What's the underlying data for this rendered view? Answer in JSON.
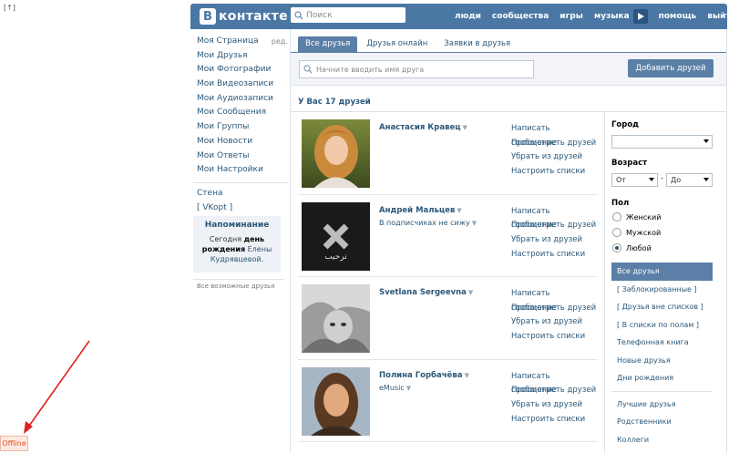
{
  "corner_mark": "[↑]",
  "header": {
    "logo_letter": "В",
    "logo_text": "контакте",
    "search_placeholder": "Поиск",
    "nav": [
      "люди",
      "сообщества",
      "игры",
      "музыка",
      "помощь",
      "выйти"
    ]
  },
  "menu": {
    "items": [
      "Моя Страница",
      "Мои Друзья",
      "Мои Фотографии",
      "Мои Видеозаписи",
      "Мои Аудиозаписи",
      "Мои Сообщения",
      "Мои Группы",
      "Мои Новости",
      "Мои Ответы",
      "Мои Настройки"
    ],
    "edit_label": "ред.",
    "wall": "Стена",
    "vkopt": "[ VKopt ]"
  },
  "reminder": {
    "title": "Напоминание",
    "text_today": "Сегодня",
    "text_bold": "день рождения",
    "text_name": "Елены Кудрявцевой",
    "text_end": "."
  },
  "possible_friends": "Все возможные друзья",
  "tabs": [
    "Все друзья",
    "Друзья онлайн",
    "Заявки в друзья"
  ],
  "friend_search_placeholder": "Начните вводить имя друга",
  "add_friends_label": "Добавить друзей",
  "friends_count": "У Вас 17 друзей",
  "actions": [
    "Написать сообщение",
    "Просмотреть друзей",
    "Убрать из друзей",
    "Настроить списки"
  ],
  "friends": [
    {
      "name": "Анастасия Кравец",
      "sub": ""
    },
    {
      "name": "Андрей Мальцев",
      "sub": "В подписчиках не сижу"
    },
    {
      "name": "Svetlana Sergeevna",
      "sub": ""
    },
    {
      "name": "Полина Горбачёва",
      "sub": "eMusic"
    }
  ],
  "avatar2_text": "ترحيب",
  "filters": {
    "city_label": "Город",
    "age_label": "Возраст",
    "age_from": "От",
    "age_dash": "-",
    "age_to": "До",
    "sex_label": "Пол",
    "sex_options": [
      "Женский",
      "Мужской",
      "Любой"
    ],
    "selected_sex": "Любой",
    "lists": [
      "Все друзья",
      "[ Заблокированные ]",
      "[ Друзья вне списков ]",
      "[ В списки по полам ]",
      "Телефонная книга",
      "Новые друзья",
      "Дни рождения"
    ],
    "lists2": [
      "Лучшие друзья",
      "Родственники",
      "Коллеги"
    ]
  },
  "offline_label": "Offline",
  "colors": {
    "header": "#4a77a4",
    "link": "#2b587a",
    "accent": "#5b7fa6",
    "annotation_arrow": "#e02020"
  }
}
